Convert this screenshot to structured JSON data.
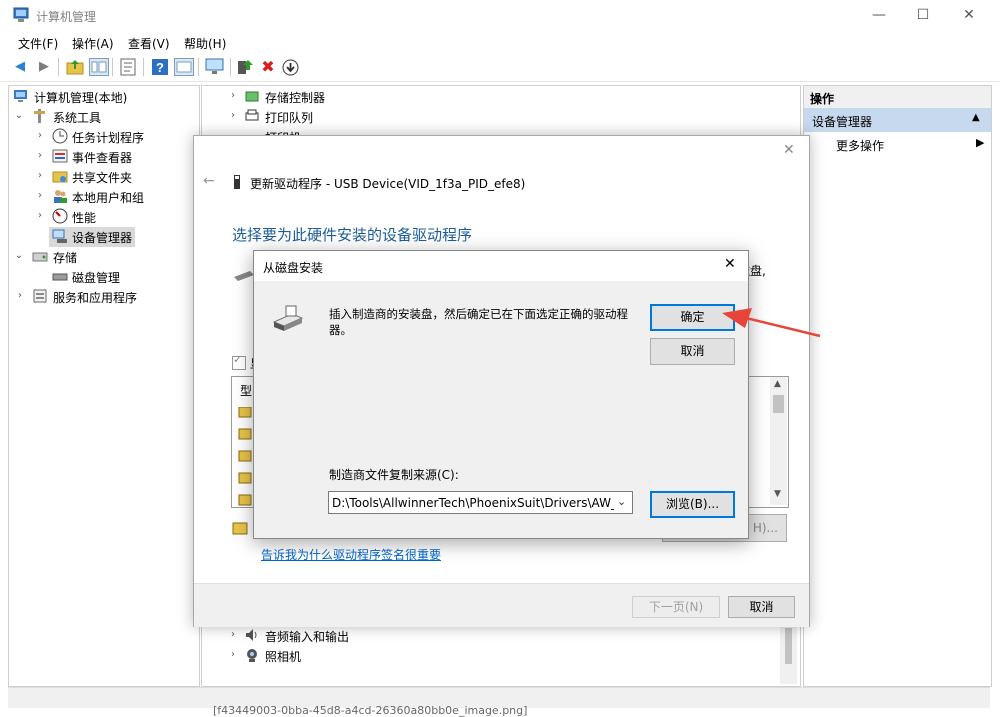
{
  "window": {
    "title": "计算机管理",
    "minimize": "—",
    "maximize": "☐",
    "close": "✕"
  },
  "menu": [
    "文件(F)",
    "操作(A)",
    "查看(V)",
    "帮助(H)"
  ],
  "tree": {
    "root": "计算机管理(本地)",
    "system_tools": "系统工具",
    "task_scheduler": "任务计划程序",
    "event_viewer": "事件查看器",
    "shared_folders": "共享文件夹",
    "local_users": "本地用户和组",
    "performance": "性能",
    "device_manager": "设备管理器",
    "storage": "存储",
    "disk_management": "磁盘管理",
    "services_apps": "服务和应用程序"
  },
  "devices": {
    "storage_controllers": "存储控制器",
    "print_queues": "打印队列",
    "printers": "打印机",
    "audio": "音频输入和输出",
    "camera": "照相机"
  },
  "actions": {
    "header": "操作",
    "section": "设备管理器",
    "more": "更多操作"
  },
  "status": {
    "bottom_text": "[f43449003-0bba-45d8-a4cd-26360a80bb0e_image.png]"
  },
  "wizard": {
    "title": "更新驱动程序 - USB Device(VID_1f3a_PID_efe8)",
    "heading": "选择要为此硬件安装的设备驱动程序",
    "partial_right": "有磁盘,",
    "checkbox_partial": "显",
    "list_header_partial": "型",
    "have_disk_partial": "H)...",
    "sign_link": "告诉我为什么驱动程序签名很重要",
    "next_button": "下一页(N)",
    "cancel_button": "取消"
  },
  "modal": {
    "title": "从磁盘安装",
    "message_line1": "插入制造商的安装盘，然后确定已在下面选定正确的驱动程",
    "message_line2": "器。",
    "ok_button": "确定",
    "cancel_button": "取消",
    "source_label": "制造商文件复制来源(C):",
    "source_value": "D:\\Tools\\AllwinnerTech\\PhoenixSuit\\Drivers\\AW_I",
    "browse_button": "浏览(B)..."
  },
  "colors": {
    "accent": "#0078d7",
    "link": "#0066cc",
    "heading": "#1c5d99",
    "annotation_arrow": "#e8443a"
  }
}
